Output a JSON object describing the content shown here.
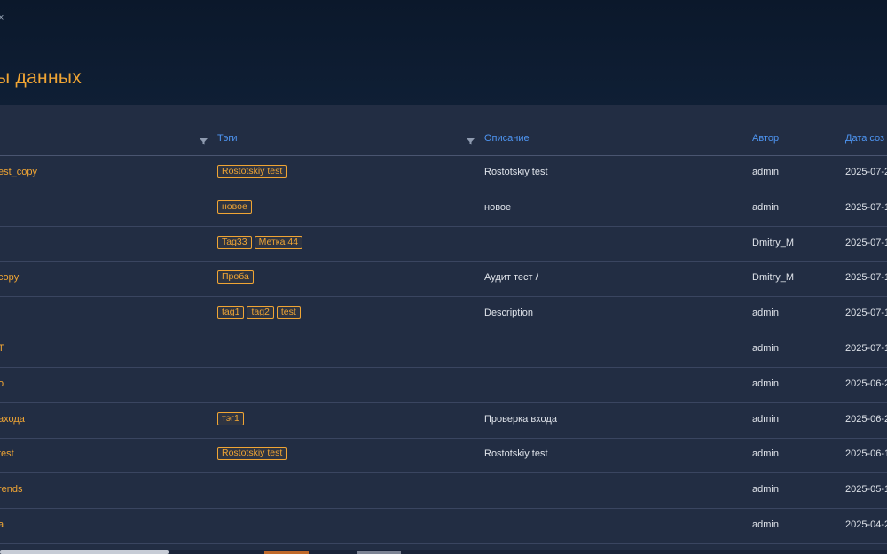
{
  "header": {
    "close_glyph": "×",
    "title": "ы данных"
  },
  "table": {
    "columns": [
      {
        "label": "Тэги"
      },
      {
        "label": "Описание"
      },
      {
        "label": "Автор"
      },
      {
        "label": "Дата соз"
      }
    ],
    "rows": [
      {
        "name": "est_copy",
        "tags": [
          "Rostotskiy test"
        ],
        "description": "Rostotskiy test",
        "author": "admin",
        "date": "2025-07-2"
      },
      {
        "name": "",
        "tags": [
          "новое"
        ],
        "description": "новое",
        "author": "admin",
        "date": "2025-07-1"
      },
      {
        "name": "",
        "tags": [
          "Tag33",
          "Метка 44"
        ],
        "description": "",
        "author": "Dmitry_M",
        "date": "2025-07-1"
      },
      {
        "name": "copy",
        "tags": [
          "Проба"
        ],
        "description": "Аудит тест /",
        "author": "Dmitry_M",
        "date": "2025-07-1"
      },
      {
        "name": "",
        "tags": [
          "tag1",
          "tag2",
          "test"
        ],
        "description": "Description",
        "author": "admin",
        "date": "2025-07-1"
      },
      {
        "name": "T",
        "tags": [],
        "description": "",
        "author": "admin",
        "date": "2025-07-1"
      },
      {
        "name": "o",
        "tags": [],
        "description": "",
        "author": "admin",
        "date": "2025-06-2"
      },
      {
        "name": "ахода",
        "tags": [
          "тэг1"
        ],
        "description": "Проверка входа",
        "author": "admin",
        "date": "2025-06-2"
      },
      {
        "name": "test",
        "tags": [
          "Rostotskiy test"
        ],
        "description": "Rostotskiy test",
        "author": "admin",
        "date": "2025-06-1"
      },
      {
        "name": "rends",
        "tags": [],
        "description": "",
        "author": "admin",
        "date": "2025-05-1"
      },
      {
        "name": "a",
        "tags": [],
        "description": "",
        "author": "admin",
        "date": "2025-04-2"
      }
    ]
  },
  "icons": {
    "filter": "filter-icon"
  },
  "colors": {
    "accent": "#f0a534",
    "header_link": "#4e95f2",
    "background": "#222d43"
  }
}
